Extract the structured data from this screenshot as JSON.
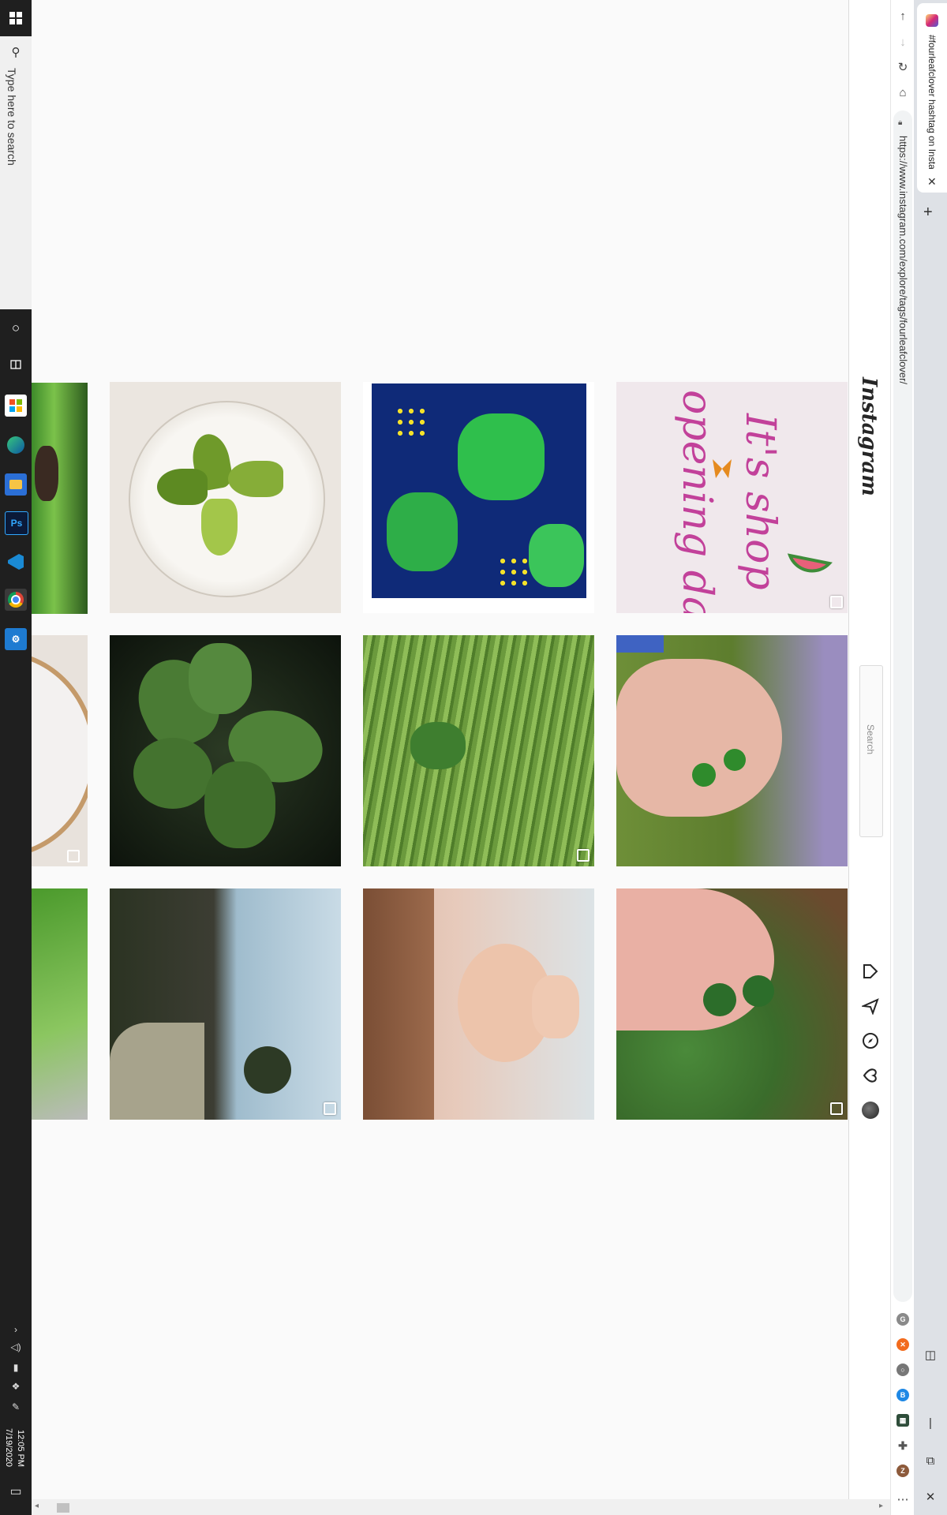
{
  "taskbar": {
    "search_placeholder": "Type here to search",
    "clock_time": "12:05 PM",
    "clock_date": "7/19/2020",
    "pinned_apps": [
      "task-view",
      "store",
      "edge",
      "file-explorer",
      "photoshop",
      "vscode",
      "chrome",
      "app-settings"
    ]
  },
  "browser": {
    "tab_title": "#fourleafclover hashtag on Insta",
    "url": "https://www.instagram.com/explore/tags/fourleafclover/",
    "extensions": [
      "ext-g",
      "ext-orange",
      "ext-circle",
      "ext-blue",
      "ext-green",
      "puzzle",
      "profile-z"
    ]
  },
  "instagram": {
    "logo": "Instagram",
    "search_placeholder": "Search",
    "nav_icons": [
      "home-icon",
      "direct-icon",
      "explore-icon",
      "activity-icon",
      "profile-avatar"
    ]
  },
  "posts": [
    {
      "id": "clover-resin-coaster",
      "multi": false
    },
    {
      "id": "clover-painting",
      "multi": false
    },
    {
      "id": "shop-opening-day",
      "multi": true,
      "text": "It's shop opening day"
    },
    {
      "id": "clover-closeup-dark",
      "multi": false
    },
    {
      "id": "clover-in-grass",
      "multi": true
    },
    {
      "id": "hand-with-clovers",
      "multi": false
    },
    {
      "id": "garden-pond-landscape",
      "multi": true
    },
    {
      "id": "woman-portrait",
      "multi": false
    },
    {
      "id": "hand-over-clover-patch",
      "multi": true
    }
  ],
  "colors": {
    "instagram_gradient": [
      "#feda75",
      "#d62976",
      "#4f5bd5"
    ],
    "taskbar": "#1f1f1f",
    "page_bg": "#fafafa"
  }
}
